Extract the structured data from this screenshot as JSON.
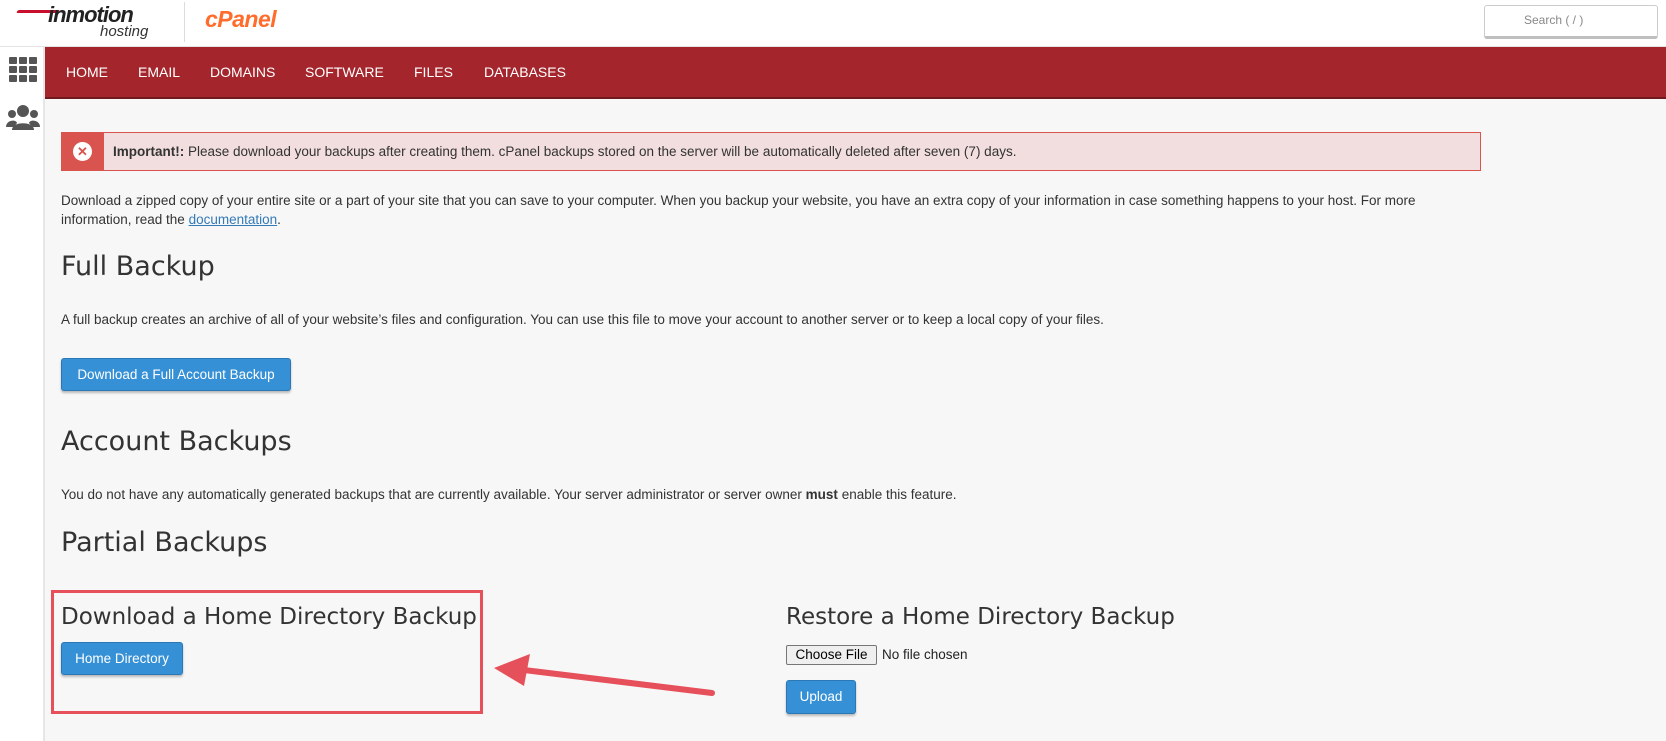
{
  "brand": {
    "name": "inmotion",
    "sub": "hosting",
    "product": "cPanel"
  },
  "search": {
    "placeholder": "Search ( / )"
  },
  "rail": {
    "grid_icon": "apps-grid-icon",
    "users_icon": "users-icon"
  },
  "nav": {
    "items": [
      "HOME",
      "EMAIL",
      "DOMAINS",
      "SOFTWARE",
      "FILES",
      "DATABASES"
    ]
  },
  "alert": {
    "label": "Important!:",
    "text": " Please download your backups after creating them. cPanel backups stored on the server will be automatically deleted after seven (7) days.",
    "icon": "close-circle-icon"
  },
  "intro": {
    "text": "Download a zipped copy of your entire site or a part of your site that you can save to your computer. When you backup your website, you have an extra copy of your information in case something happens to your host. For more information, read the ",
    "link": "documentation",
    "end": "."
  },
  "full_backup": {
    "title": "Full Backup",
    "desc": "A full backup creates an archive of all of your website’s files and configuration. You can use this file to move your account to another server or to keep a local copy of your files.",
    "button": "Download a Full Account Backup"
  },
  "account_backups": {
    "title": "Account Backups",
    "desc_before": "You do not have any automatically generated backups that are currently available. Your server administrator or server owner ",
    "desc_bold": "must",
    "desc_after": " enable this feature."
  },
  "partial_backups": {
    "title": "Partial Backups",
    "download_title": "Download a Home Directory Backup",
    "download_button": "Home Directory",
    "restore_title": "Restore a Home Directory Backup",
    "choose_file": "Choose File",
    "no_file": "No file chosen",
    "upload_button": "Upload"
  },
  "colors": {
    "nav": "#a4262c",
    "button": "#3590d6",
    "alert_bg": "#f2dede",
    "alert_border": "#d9534f",
    "annotation": "#e6505a"
  }
}
